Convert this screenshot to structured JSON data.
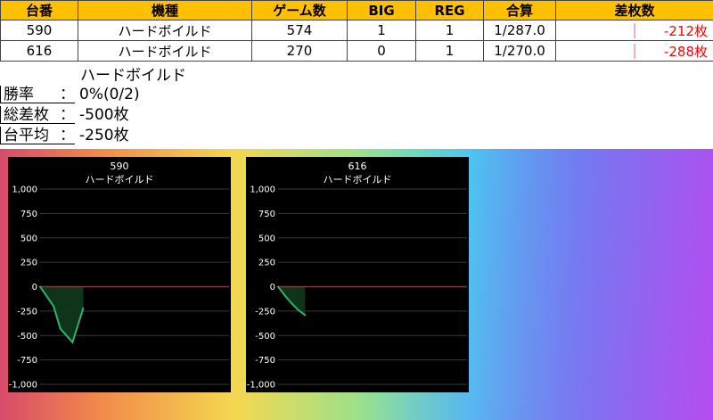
{
  "table": {
    "headers": [
      "台番",
      "機種",
      "ゲーム数",
      "BIG",
      "REG",
      "合算",
      "差枚数"
    ],
    "rows": [
      {
        "no": "590",
        "model": "ハードボイルド",
        "games": "574",
        "big": "1",
        "reg": "1",
        "combined": "1/287.0",
        "diff": "-212枚"
      },
      {
        "no": "616",
        "model": "ハードボイルド",
        "games": "270",
        "big": "0",
        "reg": "1",
        "combined": "1/270.0",
        "diff": "-288枚"
      }
    ]
  },
  "summary": {
    "title": "ハードボイルド",
    "rows": [
      {
        "label": "勝率",
        "colon": "：",
        "value": "0%(0/2)"
      },
      {
        "label": "総差枚",
        "colon": "：",
        "value": "-500枚"
      },
      {
        "label": "台平均",
        "colon": "：",
        "value": "-250枚"
      }
    ]
  },
  "colors": {
    "header_bg": "#fec000",
    "negative_text": "#ff0000",
    "line": "#2fb36a",
    "zero_line": "#c0202a"
  },
  "chart_data": [
    {
      "type": "line",
      "title": "590",
      "subtitle": "ハードボイルド",
      "ylim": [
        -1000,
        1000
      ],
      "yticks": [
        "1,000",
        "750",
        "500",
        "250",
        "0",
        "-250",
        "-500",
        "-750",
        "-1,000"
      ],
      "series": [
        {
          "x": [
            0,
            100,
            150,
            240,
            320
          ],
          "y": [
            0,
            -200,
            -430,
            -570,
            -220
          ]
        }
      ],
      "xmax": 1400,
      "grid": true
    },
    {
      "type": "line",
      "title": "616",
      "subtitle": "ハードボイルド",
      "ylim": [
        -1000,
        1000
      ],
      "yticks": [
        "1,000",
        "750",
        "500",
        "250",
        "0",
        "-250",
        "-500",
        "-750",
        "-1,000"
      ],
      "series": [
        {
          "x": [
            0,
            50,
            100,
            150,
            200
          ],
          "y": [
            0,
            -90,
            -170,
            -240,
            -290
          ]
        }
      ],
      "xmax": 1400,
      "grid": true
    }
  ]
}
